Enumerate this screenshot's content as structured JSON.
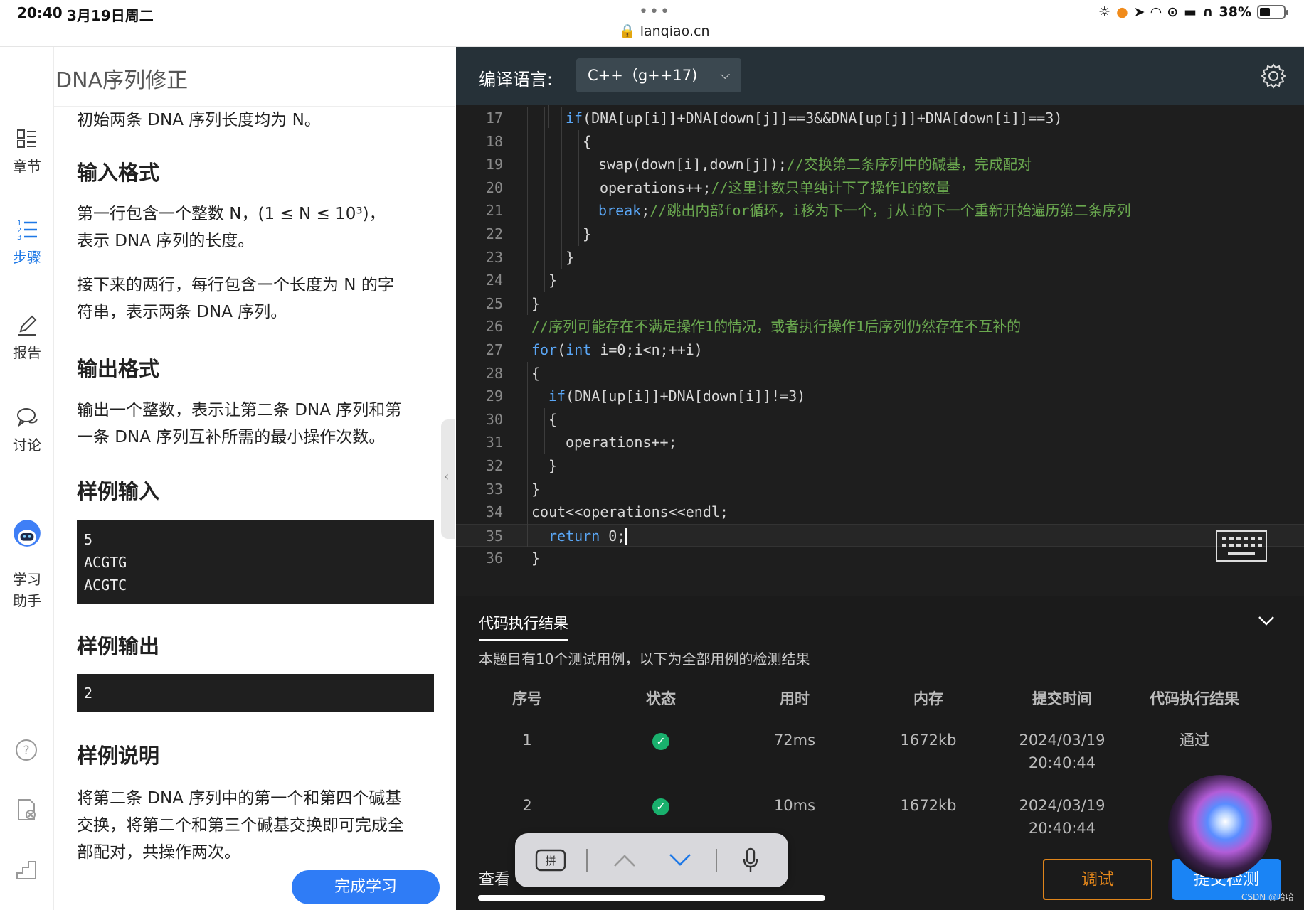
{
  "status_bar": {
    "time": "20:40",
    "date": "3月19日周二",
    "url": "lanqiao.cn",
    "battery": "38%",
    "battery_level": 0.38
  },
  "left_header": {
    "title": "DNA序列修正"
  },
  "rail": {
    "items": [
      {
        "label": "章节",
        "icon": "grid-list-icon"
      },
      {
        "label": "步骤",
        "icon": "numbered-list-icon",
        "active": true
      },
      {
        "label": "报告",
        "icon": "pencil-icon"
      },
      {
        "label": "讨论",
        "icon": "chat-bubbles-icon"
      },
      {
        "label": "学习\n助手",
        "icon": "robot-avatar-icon"
      }
    ],
    "bottom_icons": [
      "help-circle-icon",
      "document-close-icon",
      "stairs-chart-icon"
    ]
  },
  "problem": {
    "intro": "初始两条 DNA 序列长度均为 N。",
    "input_heading": "输入格式",
    "input_p1_line1": "第一行包含一个整数 N，(1 ≤ N ≤ 10³)，",
    "input_p1_line2": "表示 DNA 序列的长度。",
    "input_p2_line1": "接下来的两行，每行包含一个长度为 N 的字",
    "input_p2_line2": "符串，表示两条 DNA 序列。",
    "output_heading": "输出格式",
    "output_p_line1": "输出一个整数，表示让第二条 DNA 序列和第",
    "output_p_line2": "一条 DNA 序列互补所需的最小操作次数。",
    "sample_input_heading": "样例输入",
    "sample_input_lines": [
      "5",
      "ACGTG",
      "ACGTC"
    ],
    "sample_output_heading": "样例输出",
    "sample_output": "2",
    "sample_explain_heading": "样例说明",
    "sample_explain_line1": "将第二条 DNA 序列中的第一个和第四个碱基",
    "sample_explain_line2": "交换，将第二个和第三个碱基交换即可完成全",
    "sample_explain_line3": "部配对，共操作两次。"
  },
  "finish_button": "完成学习",
  "editor": {
    "lang_label": "编译语言:",
    "lang_value": "C++（g++17)",
    "lines": [
      {
        "n": "17",
        "parts": [
          [
            "kw",
            "if"
          ],
          [
            "t",
            "(DNA[up[i]]+DNA[down[j]]==3&&DNA[up[j]]+DNA[down[i]]==3)"
          ]
        ]
      },
      {
        "n": "18",
        "parts": [
          [
            "t",
            "{"
          ]
        ]
      },
      {
        "n": "19",
        "parts": [
          [
            "t",
            "swap(down[i],down[j]);"
          ],
          [
            "cm",
            "//交换第二条序列中的碱基，完成配对"
          ]
        ]
      },
      {
        "n": "20",
        "parts": [
          [
            "t",
            "operations++;"
          ],
          [
            "cm",
            "//这里计数只单纯计下了操作1的数量"
          ]
        ]
      },
      {
        "n": "21",
        "parts": [
          [
            "kw",
            "break"
          ],
          [
            "t",
            ";"
          ],
          [
            "cm",
            "//跳出内部for循环，i移为下一个，j从i的下一个重新开始遍历第二条序列"
          ]
        ]
      },
      {
        "n": "22",
        "parts": [
          [
            "t",
            "}"
          ]
        ]
      },
      {
        "n": "23",
        "parts": [
          [
            "t",
            "}"
          ]
        ]
      },
      {
        "n": "24",
        "parts": [
          [
            "t",
            "}"
          ]
        ]
      },
      {
        "n": "25",
        "parts": [
          [
            "t",
            "}"
          ]
        ]
      },
      {
        "n": "26",
        "parts": [
          [
            "cm",
            "//序列可能存在不满足操作1的情况，或者执行操作1后序列仍然存在不互补的"
          ]
        ]
      },
      {
        "n": "27",
        "parts": [
          [
            "kw",
            "for"
          ],
          [
            "t",
            "("
          ],
          [
            "kw",
            "int"
          ],
          [
            "t",
            " i=0;i<n;++i)"
          ]
        ]
      },
      {
        "n": "28",
        "parts": [
          [
            "t",
            "{"
          ]
        ]
      },
      {
        "n": "29",
        "parts": [
          [
            "kw",
            "if"
          ],
          [
            "t",
            "(DNA[up[i]]+DNA[down[i]]!=3)"
          ]
        ]
      },
      {
        "n": "30",
        "parts": [
          [
            "t",
            "{"
          ]
        ]
      },
      {
        "n": "31",
        "parts": [
          [
            "t",
            "operations++;"
          ]
        ]
      },
      {
        "n": "32",
        "parts": [
          [
            "t",
            "}"
          ]
        ]
      },
      {
        "n": "33",
        "parts": [
          [
            "t",
            "}"
          ]
        ]
      },
      {
        "n": "34",
        "parts": [
          [
            "t",
            "cout<<operations<<endl;"
          ]
        ]
      },
      {
        "n": "35",
        "parts": [
          [
            "kw",
            "return"
          ],
          [
            "t",
            " 0;"
          ]
        ]
      },
      {
        "n": "36",
        "parts": [
          [
            "t",
            "}"
          ]
        ]
      }
    ]
  },
  "results": {
    "tab": "代码执行结果",
    "description": "本题目有10个测试用例，以下为全部用例的检测结果",
    "headers": [
      "序号",
      "状态",
      "用时",
      "内存",
      "提交时间",
      "代码执行结果"
    ],
    "rows": [
      {
        "no": "1",
        "status": "pass",
        "time": "72ms",
        "memory": "1672kb",
        "date": "2024/03/19",
        "clock": "20:40:44",
        "result": "通过"
      },
      {
        "no": "2",
        "status": "pass",
        "time": "10ms",
        "memory": "1672kb",
        "date": "2024/03/19",
        "clock": "20:40:44",
        "result": ""
      }
    ],
    "view_more": "查看",
    "debug_button": "调试",
    "submit_button": "提交检测",
    "watermark": "CSDN @哈哈"
  },
  "keyboard_toolbar": {
    "items": [
      "pinyin-key-icon",
      "chevron-up-icon",
      "chevron-down-icon",
      "microphone-icon"
    ]
  },
  "colors": {
    "accent": "#1e78e6",
    "editor_bg": "#1e1e1e",
    "header_bg": "#263138",
    "keyword": "#5aa6f5",
    "comment": "#6aa84f",
    "debug": "#e0851b",
    "submit": "#1a84f5",
    "pass": "#19b06d"
  }
}
